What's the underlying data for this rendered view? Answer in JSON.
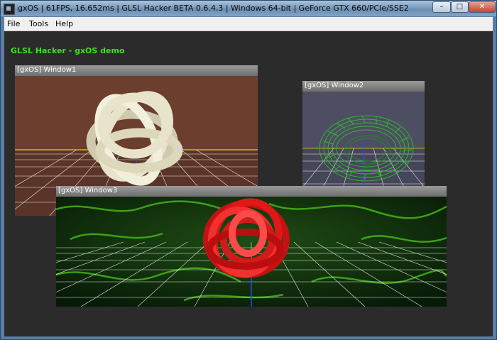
{
  "window": {
    "title": "gxOS | 61FPS, 16.652ms | GLSL Hacker BETA 0.6.4.3 | Windows 64-bit | GeForce GTX 660/PCIe/SSE2",
    "controls": {
      "minimize": "–",
      "maximize": "□",
      "close": "✕"
    }
  },
  "menu": {
    "items": [
      "File",
      "Tools",
      "Help"
    ]
  },
  "demo": {
    "title": "GLSL Hacker - gxOS demo"
  },
  "gx_windows": [
    {
      "title": "[gxOS] Window1",
      "background": "#6b3e2e",
      "object_color": "#e8e4cc"
    },
    {
      "title": "[gxOS] Window2",
      "background": "#4e4e62",
      "object_color": "#2db82d"
    },
    {
      "title": "[gxOS] Window3",
      "background": "#0e2a0e",
      "object_color": "#e01818"
    }
  ],
  "colors": {
    "desktop": "#2b2b2b",
    "demo_title": "#3ee01f",
    "grid_line": "#ffffff",
    "grid_edge": "#e6d21c",
    "axis": "#2a4cff"
  }
}
